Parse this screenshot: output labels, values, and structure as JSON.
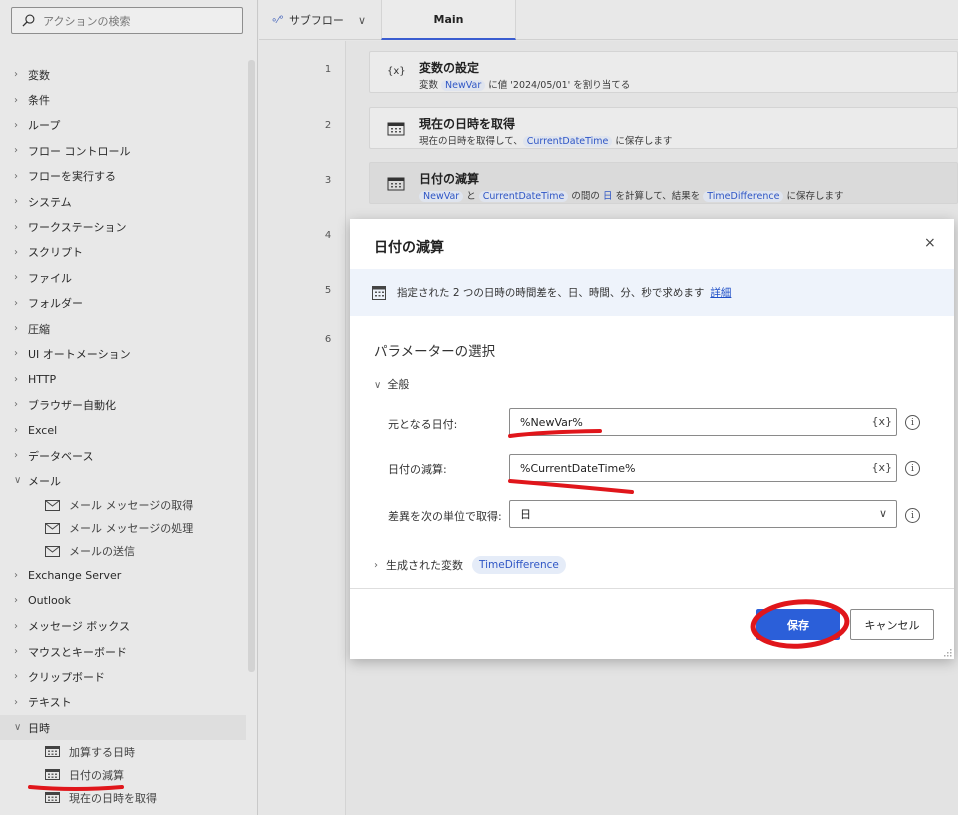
{
  "search": {
    "placeholder": "アクションの検索",
    "icon": "search-icon"
  },
  "sidebar": {
    "items": [
      {
        "label": "変数",
        "expanded": false
      },
      {
        "label": "条件",
        "expanded": false
      },
      {
        "label": "ループ",
        "expanded": false
      },
      {
        "label": "フロー コントロール",
        "expanded": false
      },
      {
        "label": "フローを実行する",
        "expanded": false
      },
      {
        "label": "システム",
        "expanded": false
      },
      {
        "label": "ワークステーション",
        "expanded": false
      },
      {
        "label": "スクリプト",
        "expanded": false
      },
      {
        "label": "ファイル",
        "expanded": false
      },
      {
        "label": "フォルダー",
        "expanded": false
      },
      {
        "label": "圧縮",
        "expanded": false
      },
      {
        "label": "UI オートメーション",
        "expanded": false
      },
      {
        "label": "HTTP",
        "expanded": false
      },
      {
        "label": "ブラウザー自動化",
        "expanded": false
      },
      {
        "label": "Excel",
        "expanded": false
      },
      {
        "label": "データベース",
        "expanded": false
      },
      {
        "label": "メール",
        "expanded": true
      },
      {
        "label": "Exchange Server",
        "expanded": false
      },
      {
        "label": "Outlook",
        "expanded": false
      },
      {
        "label": "メッセージ ボックス",
        "expanded": false
      },
      {
        "label": "マウスとキーボード",
        "expanded": false
      },
      {
        "label": "クリップボード",
        "expanded": false
      },
      {
        "label": "テキスト",
        "expanded": false
      },
      {
        "label": "日時",
        "expanded": true
      }
    ],
    "mail_children": [
      "メール メッセージの取得",
      "メール メッセージの処理",
      "メールの送信"
    ],
    "datetime_children": [
      "加算する日時",
      "日付の減算",
      "現在の日時を取得"
    ]
  },
  "topbar": {
    "subflow_label": "サブフロー",
    "tab_main": "Main"
  },
  "flow": {
    "line_numbers": [
      "1",
      "2",
      "3",
      "4",
      "5",
      "6"
    ],
    "steps": [
      {
        "icon": "{x}",
        "title": "変数の設定",
        "desc_parts": [
          "変数 ",
          "NewVar",
          " に値 '2024/05/01' を割り当てる"
        ]
      },
      {
        "icon": "calendar-icon",
        "title": "現在の日時を取得",
        "desc_parts": [
          "現在の日時を取得して、",
          "CurrentDateTime",
          " に保存します"
        ]
      },
      {
        "icon": "calendar-icon",
        "title": "日付の減算",
        "desc_parts": [
          "NewVar",
          " と ",
          "CurrentDateTime",
          " の間の ",
          "日",
          " を計算して、結果を ",
          "TimeDifference",
          " に保存します"
        ]
      }
    ]
  },
  "dialog": {
    "title": "日付の減算",
    "close": "×",
    "info_text": "指定された 2 つの日時の時間差を、日、時間、分、秒で求めます",
    "info_link": "詳細",
    "params_heading": "パラメーターの選択",
    "general_heading": "全般",
    "fields": [
      {
        "label": "元となる日付:",
        "value": "%NewVar%",
        "suffix": "{x}"
      },
      {
        "label": "日付の減算:",
        "value": "%CurrentDateTime%",
        "suffix": "{x}"
      },
      {
        "label": "差異を次の単位で取得:",
        "value": "日",
        "suffix": "∨"
      }
    ],
    "info_glyph": "i",
    "generated_vars_label": "生成された変数",
    "generated_var": "TimeDifference",
    "save": "保存",
    "cancel": "キャンセル"
  },
  "colors": {
    "accent": "#2b5fd9",
    "annotation": "#e0161b",
    "var_text": "#2f56c5"
  }
}
